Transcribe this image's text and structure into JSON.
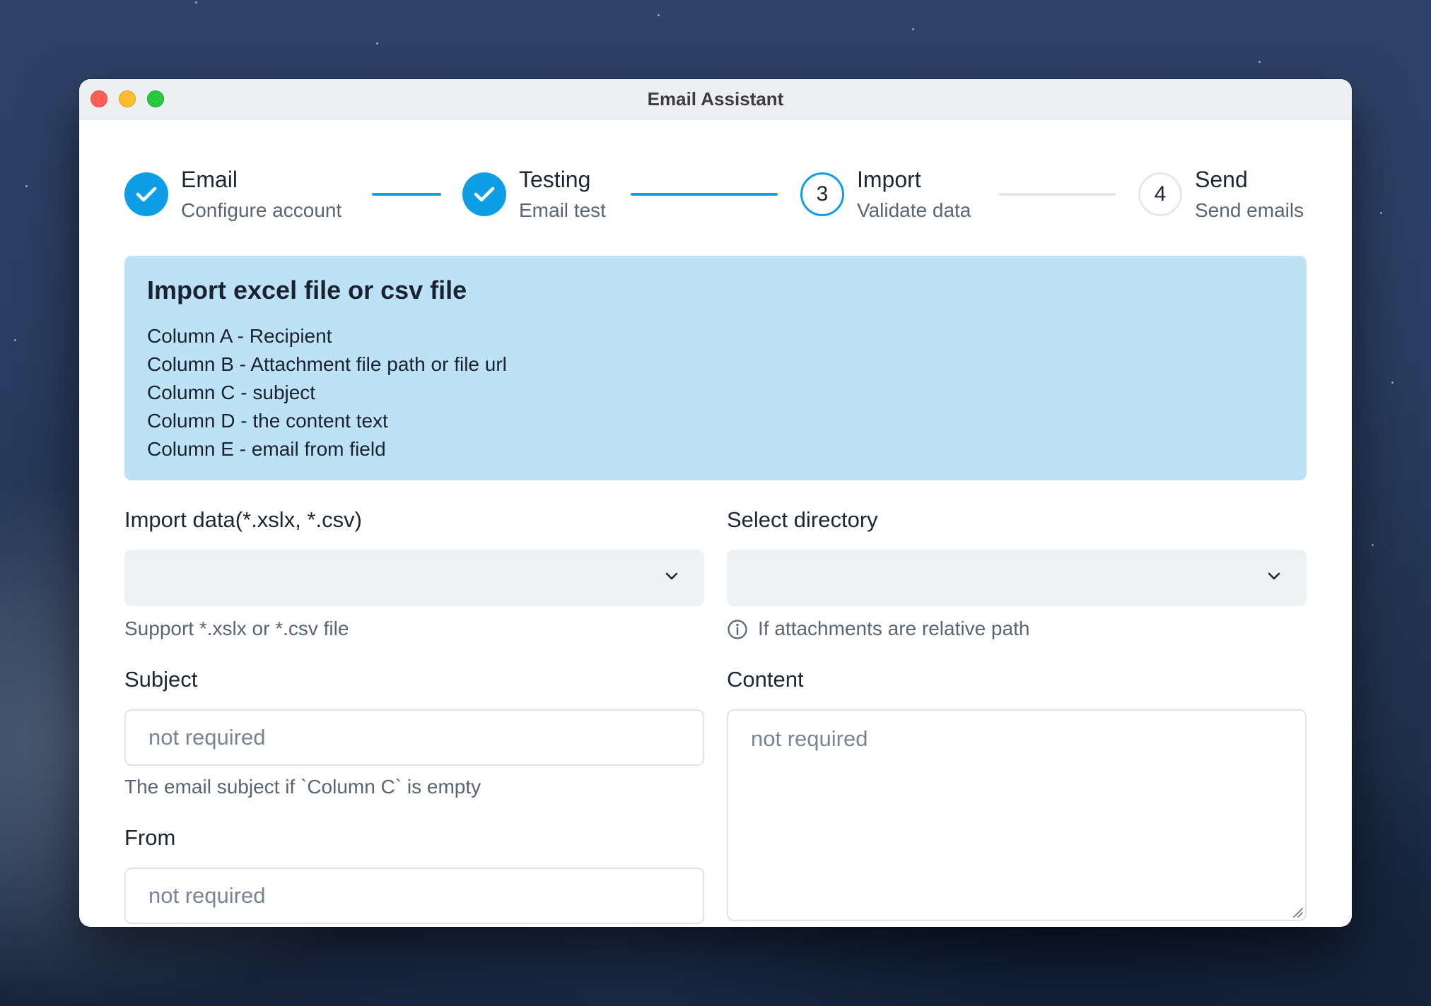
{
  "window": {
    "title": "Email Assistant"
  },
  "stepper": {
    "steps": [
      {
        "title": "Email",
        "subtitle": "Configure account",
        "state": "done",
        "number": ""
      },
      {
        "title": "Testing",
        "subtitle": "Email test",
        "state": "done",
        "number": ""
      },
      {
        "title": "Import",
        "subtitle": "Validate data",
        "state": "active",
        "number": "3"
      },
      {
        "title": "Send",
        "subtitle": "Send emails",
        "state": "pending",
        "number": "4"
      }
    ]
  },
  "info_panel": {
    "title": "Import excel file or csv file",
    "lines": [
      "Column A - Recipient",
      "Column B - Attachment file path or file url",
      "Column C - subject",
      "Column D - the content text",
      "Column E - email from field"
    ]
  },
  "form": {
    "import_data": {
      "label": "Import data(*.xslx, *.csv)",
      "value": "",
      "hint": "Support *.xslx or *.csv file"
    },
    "select_directory": {
      "label": "Select directory",
      "value": "",
      "hint": "If attachments are relative path"
    },
    "subject": {
      "label": "Subject",
      "placeholder": "not required",
      "hint": "The email subject if `Column C` is empty"
    },
    "content": {
      "label": "Content",
      "placeholder": "not required"
    },
    "from": {
      "label": "From",
      "placeholder": "not required"
    }
  },
  "colors": {
    "accent": "#0e9ee6",
    "info_background": "#bde2f6",
    "select_background": "#eef1f4"
  },
  "icons": {
    "step_done": "check-icon",
    "select": "chevron-down-icon",
    "hint": "info-circle-icon"
  }
}
